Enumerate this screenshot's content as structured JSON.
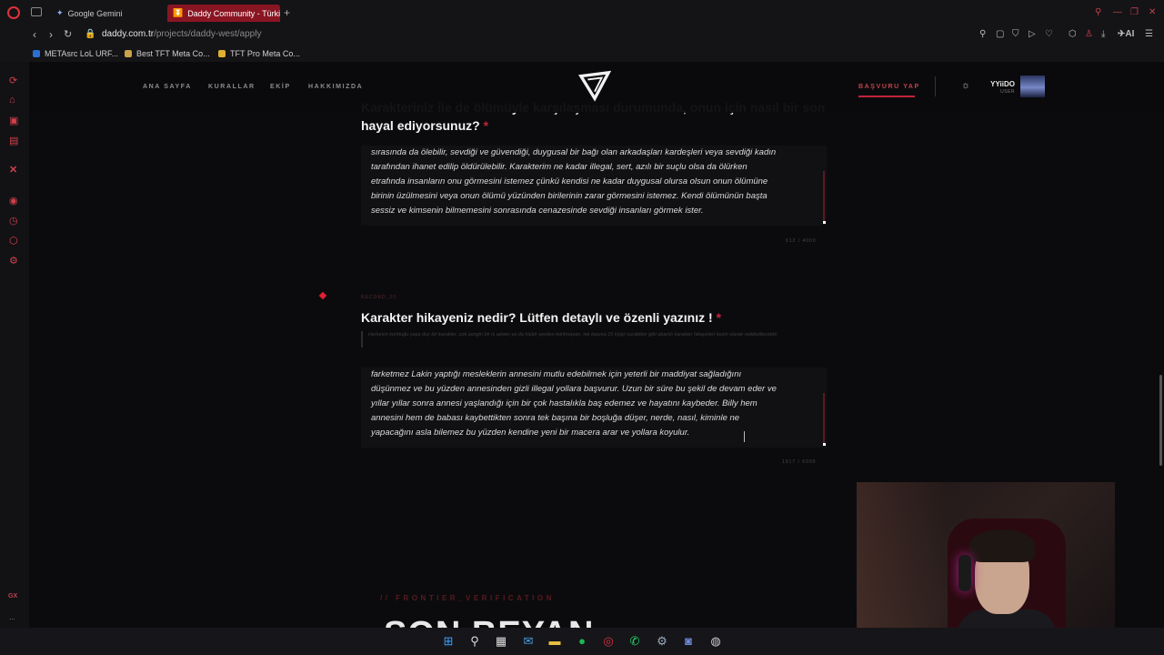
{
  "browser": {
    "tabs": [
      {
        "label": "Google Gemini",
        "icon": "gemini-icon"
      },
      {
        "label": "Daddy Community - Türkiy",
        "icon": "daddy-icon",
        "active": true
      }
    ],
    "url_domain": "daddy.com.tr",
    "url_path": "/projects/daddy-west/apply",
    "bookmarks": [
      "METAsrc LoL URF...",
      "Best TFT Meta Co...",
      "TFT Pro Meta Co..."
    ],
    "tool_text": "AI",
    "gx_label": "GX",
    "more": "..."
  },
  "site": {
    "nav": [
      "ANA SAYFA",
      "KURALLAR",
      "EKİP",
      "HAKKIMIZDA"
    ],
    "apply_label": "BAŞVURU YAP",
    "user_name": "YYiiDO",
    "user_role": "USER"
  },
  "form": {
    "q1_title_line1": "Karakteriniz ile de ölümüyle karşılaşması durumunda, onun için nasıl bir son",
    "q1_title_line2": "hayal ediyorsunuz?",
    "q1_answer": [
      "sırasında da ölebilir, sevdiği ve güvendiği, duygusal bir bağı olan arkadaşları kardeşleri veya sevdiği kadın",
      "tarafından ihanet edilip öldürülebilir. Karakterim ne kadar illegal, sert, azılı bir suçlu olsa da ölürken",
      "etrafında insanların onu görmesini istemez çünkü kendisi ne kadar duygusal olursa olsun onun ölümüne",
      "birinin üzülmesini veya onun ölümü yüzünden birilerinin zarar görmesini istemez. Kendi ölümünün başta",
      "sessiz ve kimsenin bilmemesini sonrasında cenazesinde sevdiği insanları görmek ister."
    ],
    "q1_counter": "612 / 4000",
    "q2_tag": "RECORD_10",
    "q2_title": "Karakter hikayeniz nedir? Lütfen detaylı ve özenli yazınız !",
    "q2_hint": "Herkesin korktuğu yaşa dışı bir karakter, çok zengin bir iş adamı ya da hiçbir şeyden korkmayan, tek başına 15 kişiyi vurabilen gibi abartılı karakter hikayeleri kesin olarak reddedilecektir.",
    "q2_answer": [
      "farketmez Lakin yaptığı mesleklerin annesini mutlu edebilmek için yeterli bir maddiyat sağladığını",
      "düşünmez ve bu yüzden annesinden gizli illegal yollara başvurur. Uzun bir süre bu şekil de devam eder ve",
      "yıllar yıllar sonra annesi yaşlandığı için bir çok hastalıkla baş edemez ve hayatını kaybeder. Billy hem",
      "annesini hem de babası kaybettikten sonra tek başına bir boşluğa düşer, nerde, nasıl, kiminle ne",
      "yapacağını asla bilemez bu yüzden kendine yeni bir macera arar ve yollara koyulur."
    ],
    "q2_counter": "1917 / 6000",
    "frontier_label": "// FRONTIER_VERIFICATION",
    "final_heading": "SON BEYAN"
  },
  "colors": {
    "accent": "#c2243a",
    "bg": "#0b0b0d"
  }
}
